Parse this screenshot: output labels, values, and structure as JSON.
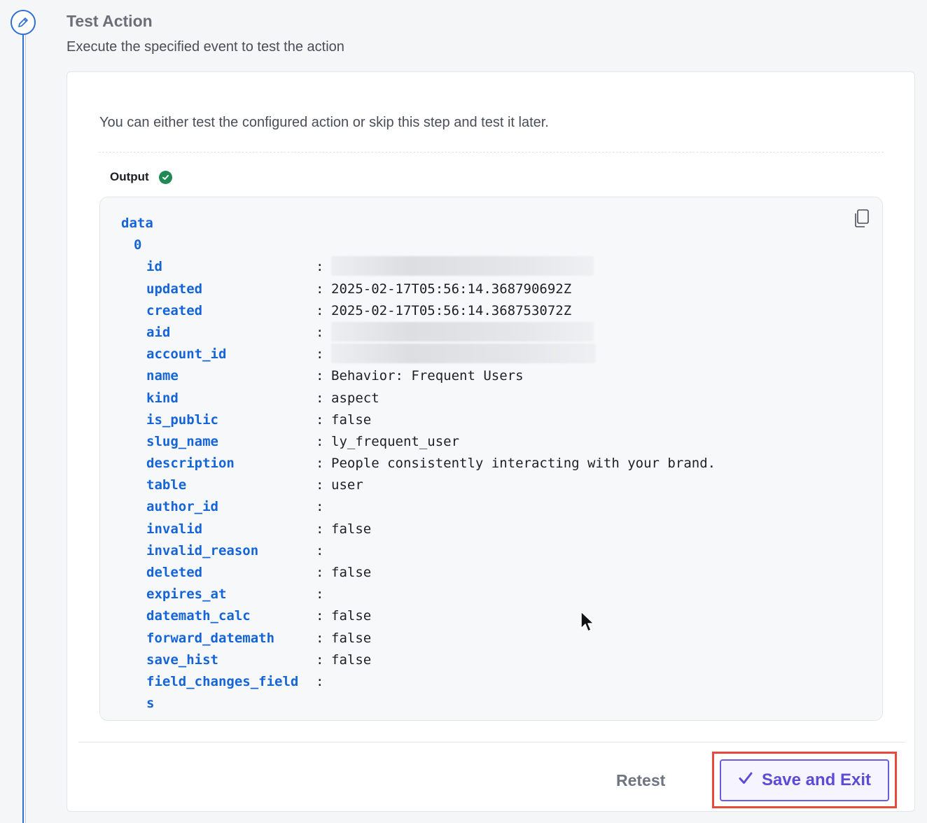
{
  "step": {
    "icon": "pencil-icon",
    "title": "Test Action",
    "subtitle": "Execute the specified event to test the action"
  },
  "card": {
    "intro": "You can either test the configured action or skip this step and test it later.",
    "output_label": "Output",
    "output_status_icon": "check-circle-icon"
  },
  "code": {
    "root_key": "data",
    "index_key": "0",
    "fields": [
      {
        "key": "id",
        "value": "",
        "redacted": true
      },
      {
        "key": "updated",
        "value": "2025-02-17T05:56:14.368790692Z"
      },
      {
        "key": "created",
        "value": "2025-02-17T05:56:14.368753072Z"
      },
      {
        "key": "aid",
        "value": "",
        "redacted": true
      },
      {
        "key": "account_id",
        "value": "",
        "redacted": true
      },
      {
        "key": "name",
        "value": "Behavior: Frequent Users"
      },
      {
        "key": "kind",
        "value": "aspect"
      },
      {
        "key": "is_public",
        "value": "false"
      },
      {
        "key": "slug_name",
        "value": "ly_frequent_user"
      },
      {
        "key": "description",
        "value": "People consistently interacting with your brand."
      },
      {
        "key": "table",
        "value": "user"
      },
      {
        "key": "author_id",
        "value": ""
      },
      {
        "key": "invalid",
        "value": "false"
      },
      {
        "key": "invalid_reason",
        "value": ""
      },
      {
        "key": "deleted",
        "value": "false"
      },
      {
        "key": "expires_at",
        "value": ""
      },
      {
        "key": "datemath_calc",
        "value": "false"
      },
      {
        "key": "forward_datemath",
        "value": "false"
      },
      {
        "key": "save_hist",
        "value": "false"
      },
      {
        "key": "field_changes_field",
        "value": ""
      },
      {
        "key": "s",
        "value": "",
        "wrap": true
      }
    ],
    "separator": ":"
  },
  "footer": {
    "retest_label": "Retest",
    "save_label": "Save and Exit",
    "save_icon": "checkmark-icon"
  },
  "colors": {
    "accent": "#5b4bd6",
    "key": "#1565d8",
    "success": "#1f8a55",
    "highlight": "#e9493b"
  }
}
